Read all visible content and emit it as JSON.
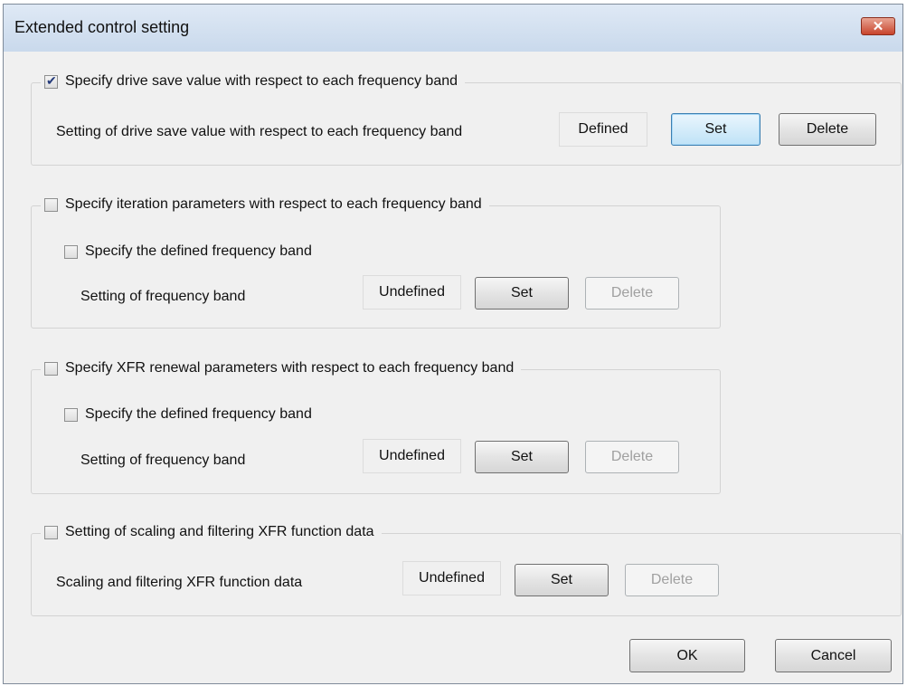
{
  "window": {
    "title": "Extended control setting"
  },
  "drive_group": {
    "checkbox_label": "Specify drive save value with respect to each frequency band",
    "checked": true,
    "setting_label": "Setting of drive save value with respect to each frequency band",
    "status": "Defined",
    "set_label": "Set",
    "delete_label": "Delete"
  },
  "iteration_group": {
    "checkbox_label": "Specify iteration parameters with respect to each frequency band",
    "checked": false,
    "sub_checkbox_label": "Specify the defined frequency band",
    "sub_checked": false,
    "setting_label": "Setting of frequency band",
    "status": "Undefined",
    "set_label": "Set",
    "delete_label": "Delete"
  },
  "xfr_group": {
    "checkbox_label": "Specify XFR renewal parameters with respect to each frequency band",
    "checked": false,
    "sub_checkbox_label": "Specify the defined frequency band",
    "sub_checked": false,
    "setting_label": "Setting of frequency band",
    "status": "Undefined",
    "set_label": "Set",
    "delete_label": "Delete"
  },
  "scaling_group": {
    "checkbox_label": "Setting of scaling and filtering XFR function data",
    "checked": false,
    "setting_label": "Scaling and filtering XFR function data",
    "status": "Undefined",
    "set_label": "Set",
    "delete_label": "Delete"
  },
  "footer": {
    "ok_label": "OK",
    "cancel_label": "Cancel"
  }
}
